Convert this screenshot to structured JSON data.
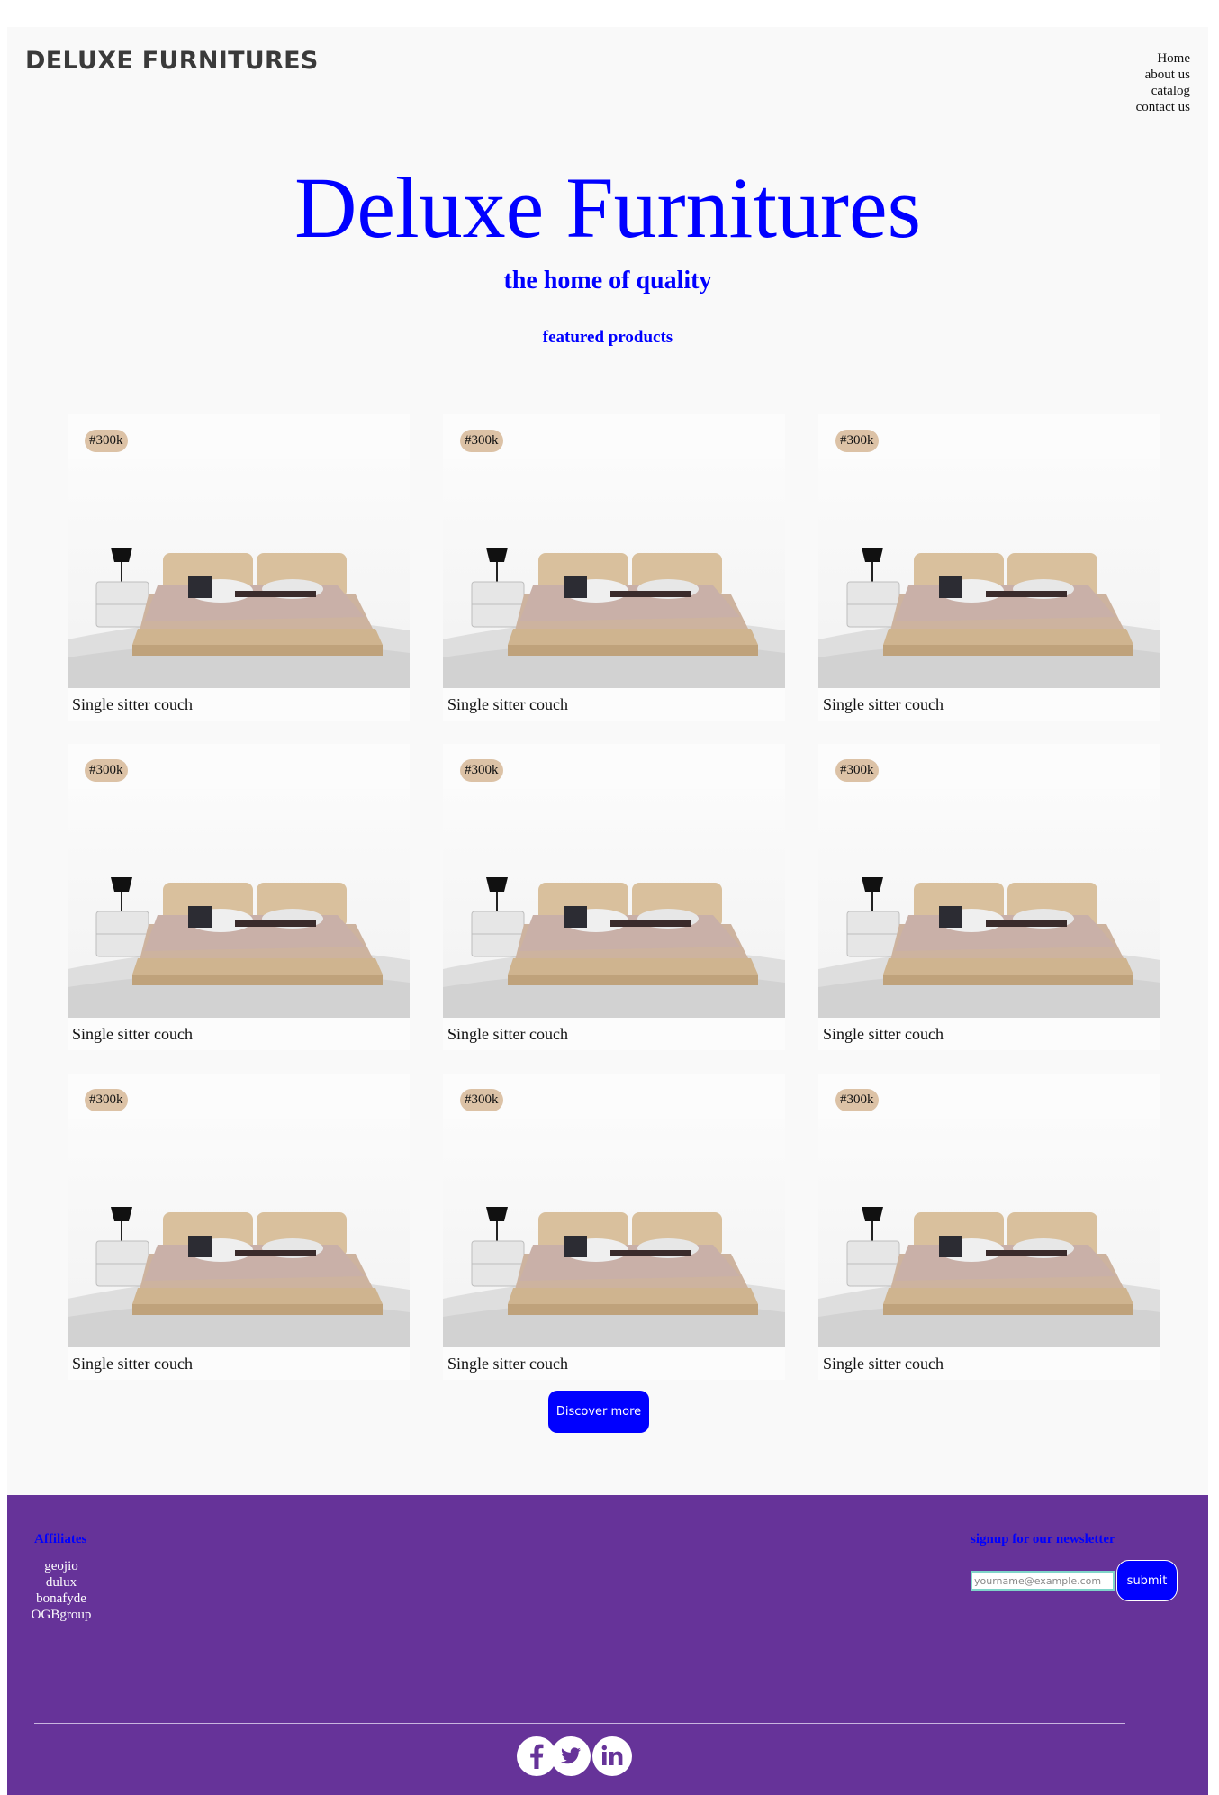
{
  "header": {
    "brand": "DELUXE FURNITURES",
    "nav": [
      "Home",
      "about us",
      "catalog",
      "contact us"
    ]
  },
  "hero": {
    "title": "Deluxe Furnitures",
    "subtitle": "the home of quality",
    "section_title": "featured products"
  },
  "products": [
    {
      "price": "#300k",
      "name": "Single sitter couch"
    },
    {
      "price": "#300k",
      "name": "Single sitter couch"
    },
    {
      "price": "#300k",
      "name": "Single sitter couch"
    },
    {
      "price": "#300k",
      "name": "Single sitter couch"
    },
    {
      "price": "#300k",
      "name": "Single sitter couch"
    },
    {
      "price": "#300k",
      "name": "Single sitter couch"
    },
    {
      "price": "#300k",
      "name": "Single sitter couch"
    },
    {
      "price": "#300k",
      "name": "Single sitter couch"
    },
    {
      "price": "#300k",
      "name": "Single sitter couch"
    }
  ],
  "discover_label": "Discover more",
  "footer": {
    "affiliates_title": "Affiliates",
    "affiliates": [
      "geojio",
      "dulux",
      "bonafyde",
      "OGBgroup"
    ],
    "newsletter_title": "signup for our newsletter",
    "email_placeholder": "yourname@example.com",
    "submit_label": "submit",
    "social": [
      "facebook-icon",
      "twitter-icon",
      "linkedin-icon"
    ]
  },
  "colors": {
    "accent": "#0000ff",
    "footer_bg": "#663399",
    "price_badge": "#dcc2a6"
  }
}
